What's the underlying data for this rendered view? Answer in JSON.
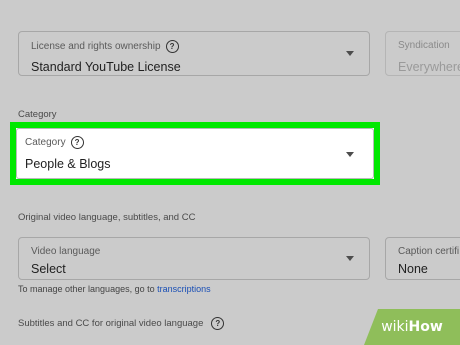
{
  "license": {
    "label": "License and rights ownership",
    "value": "Standard YouTube License"
  },
  "syndication": {
    "label": "Syndication",
    "value": "Everywhere"
  },
  "category_section": {
    "heading": "Category",
    "field_label": "Category",
    "value": "People & Blogs"
  },
  "language_section": {
    "heading": "Original video language, subtitles, and CC",
    "video_language_label": "Video language",
    "video_language_value": "Select",
    "caption_label": "Caption certifi",
    "caption_value": "None",
    "helper_text": "To manage other languages, go to",
    "helper_link": "transcriptions",
    "subtitles_heading": "Subtitles and CC for original video language"
  },
  "watermark": {
    "wiki": "wiki",
    "how": "How"
  },
  "colors": {
    "highlight": "#00e800",
    "background": "#cbcbcb",
    "link": "#1a4fb5",
    "watermark": "#8fbe5a"
  },
  "icons": [
    "help-icon",
    "dropdown-caret-icon"
  ]
}
